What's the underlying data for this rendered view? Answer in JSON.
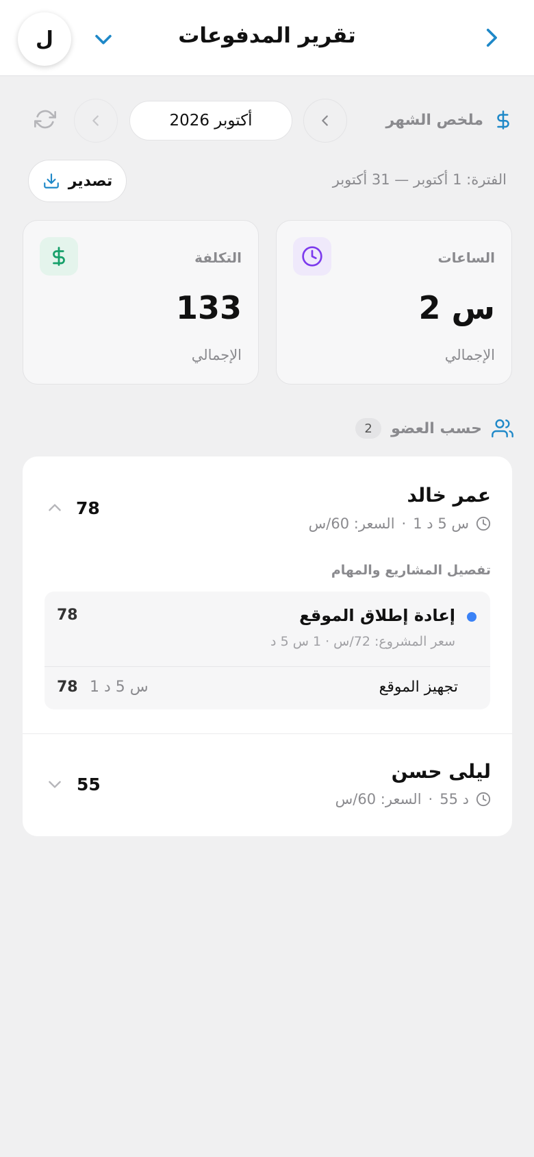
{
  "header": {
    "title": "تقرير المدفوعات",
    "avatar_letter": "ل"
  },
  "month": {
    "summary_label": "ملخص الشهر",
    "current": "أكتوبر 2026"
  },
  "period": {
    "text": "الفترة: 1 أكتوبر — 31 أكتوبر"
  },
  "export": {
    "label": "تصدير"
  },
  "stats": {
    "hours": {
      "label": "الساعات",
      "value": "2 س",
      "sub": "الإجمالي"
    },
    "cost": {
      "label": "التكلفة",
      "value": "133",
      "sub": "الإجمالي"
    }
  },
  "members_section": {
    "title": "حسب العضو",
    "count": "2"
  },
  "members": [
    {
      "name": "عمر خالد",
      "duration": "1 س 5 د",
      "rate": "السعر: 60/س",
      "amount": "78",
      "expanded": true,
      "breakdown_title": "تفصيل المشاريع والمهام",
      "project": {
        "name": "إعادة إطلاق الموقع",
        "meta": "سعر المشروع: 72/س · 1 س 5 د",
        "amount": "78",
        "dot_color": "#3b82f6"
      },
      "task": {
        "name": "تجهيز الموقع",
        "duration": "1 س 5 د",
        "amount": "78"
      }
    },
    {
      "name": "ليلى حسن",
      "duration": "55 د",
      "rate": "السعر: 60/س",
      "amount": "55",
      "expanded": false
    }
  ],
  "colors": {
    "accent": "#1e88c8",
    "hours_icon": "#7c3aed",
    "hours_icon_bg": "#efe9fb",
    "cost_icon": "#16a06a",
    "cost_icon_bg": "#e4f4ec"
  },
  "icons": {
    "back": "chevron-right-icon",
    "menu": "chevron-down-icon",
    "summary": "dollar-icon",
    "prev": "chevron-left-icon",
    "next": "chevron-left-icon",
    "refresh": "refresh-icon",
    "export": "download-icon",
    "hours": "clock-icon",
    "cost": "dollar-icon",
    "members": "users-icon"
  }
}
